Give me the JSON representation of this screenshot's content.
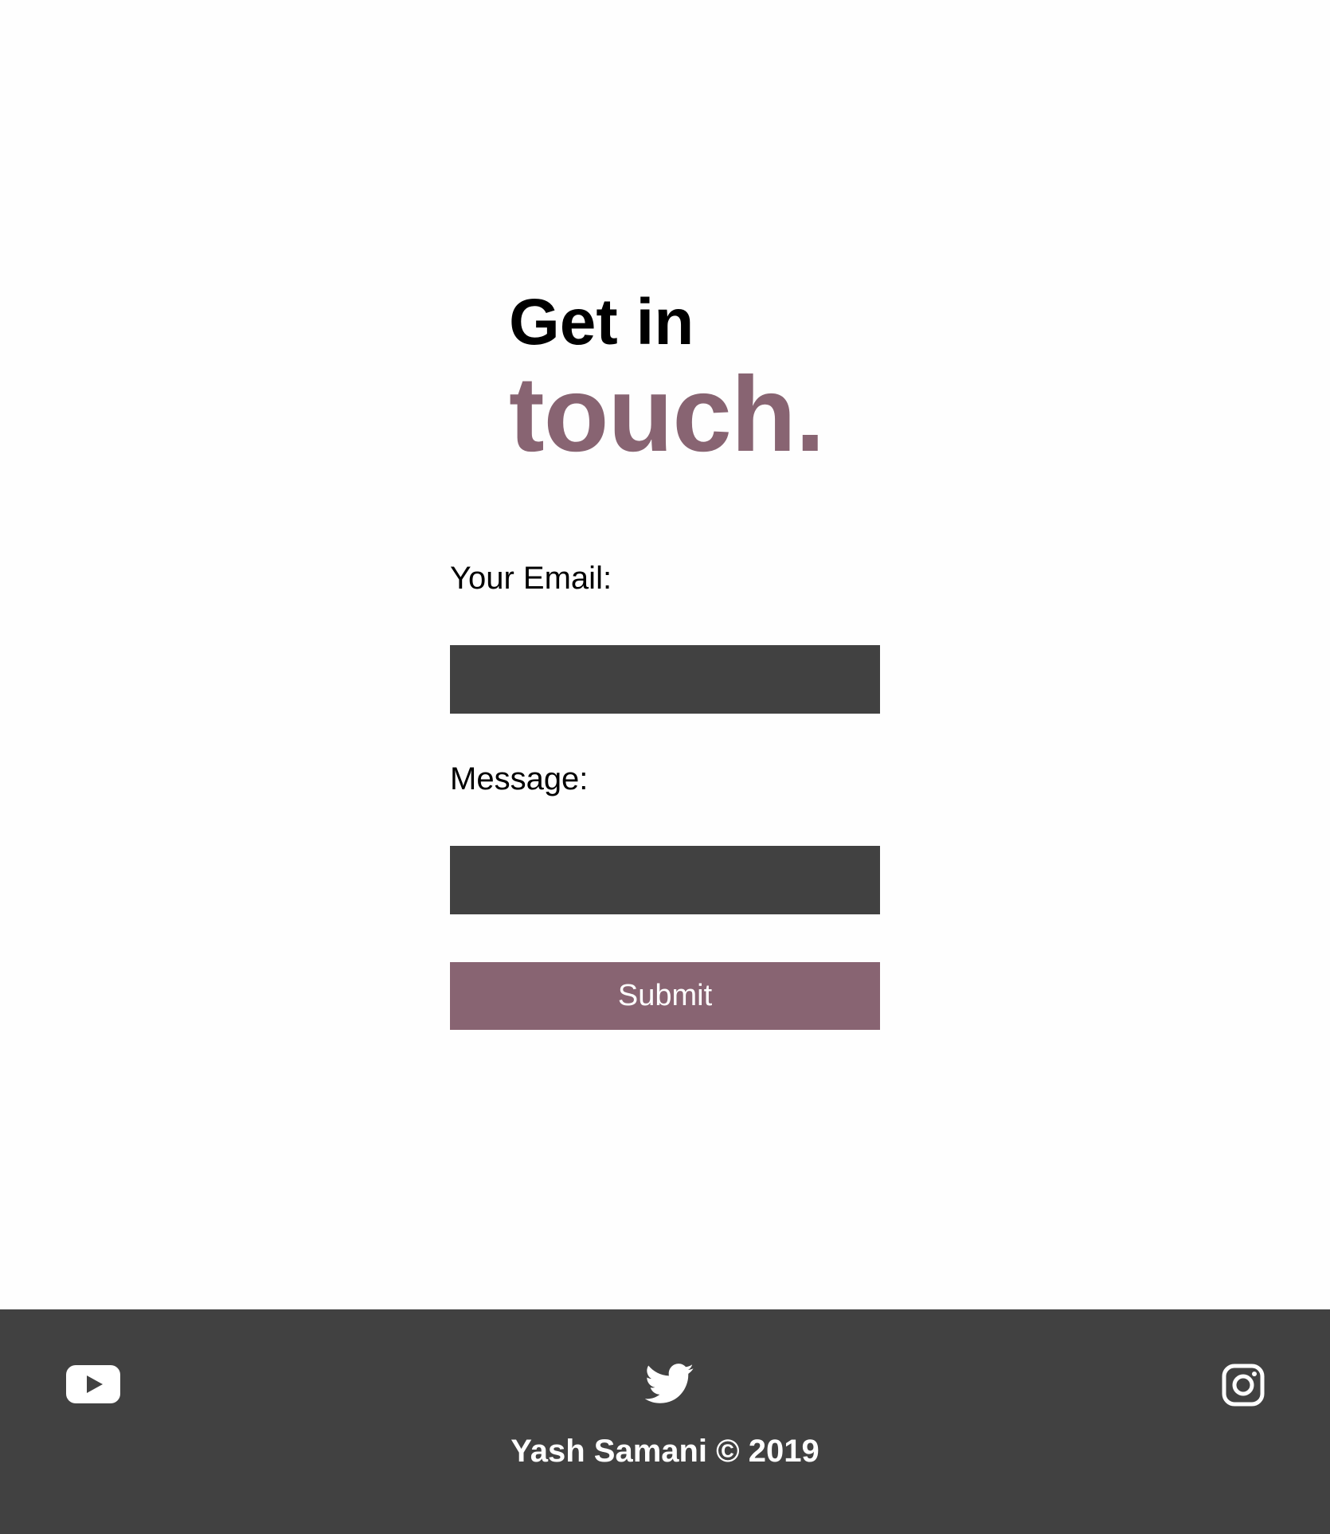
{
  "heading": {
    "line1": "Get in",
    "line2": "touch."
  },
  "form": {
    "email_label": "Your Email:",
    "email_value": "",
    "message_label": "Message:",
    "message_value": "",
    "submit_label": "Submit"
  },
  "footer": {
    "social": [
      {
        "name": "youtube",
        "icon": "youtube-icon"
      },
      {
        "name": "twitter",
        "icon": "twitter-icon"
      },
      {
        "name": "instagram",
        "icon": "instagram-icon"
      }
    ],
    "copyright": "Yash Samani © 2019"
  },
  "colors": {
    "accent": "#886472",
    "dark": "#414141",
    "background": "#fefefe"
  }
}
